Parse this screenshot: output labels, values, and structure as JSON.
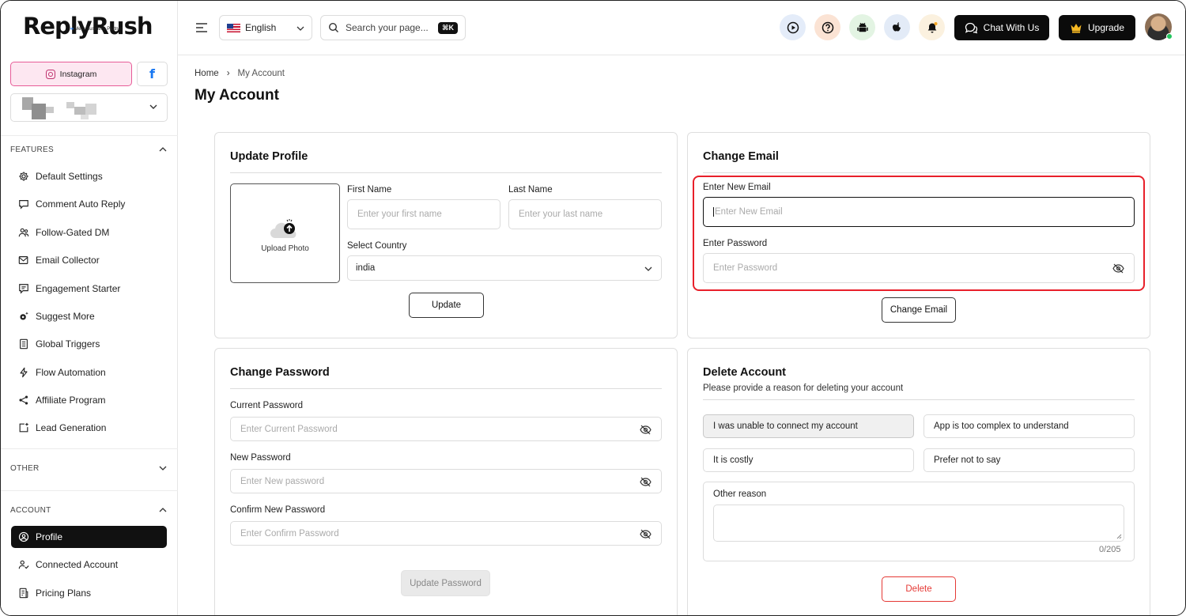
{
  "brand": {
    "name": "ReplyRush",
    "tagline": "Meta Business Partner"
  },
  "sidebar": {
    "platform_buttons": {
      "instagram": "Instagram",
      "facebook": "f"
    },
    "sections": {
      "features": "FEATURES",
      "other": "OTHER",
      "account": "ACCOUNT"
    },
    "features_items": [
      {
        "label": "Default Settings",
        "icon": "gear-icon"
      },
      {
        "label": "Comment Auto Reply",
        "icon": "comment-icon"
      },
      {
        "label": "Follow-Gated DM",
        "icon": "users-icon"
      },
      {
        "label": "Email Collector",
        "icon": "mail-icon"
      },
      {
        "label": "Engagement Starter",
        "icon": "chat-lines-icon"
      },
      {
        "label": "Suggest More",
        "icon": "sparkle-gear-icon"
      },
      {
        "label": "Global Triggers",
        "icon": "document-icon"
      },
      {
        "label": "Flow Automation",
        "icon": "bolt-icon"
      },
      {
        "label": "Affiliate Program",
        "icon": "share-icon"
      },
      {
        "label": "Lead Generation",
        "icon": "add-box-icon"
      }
    ],
    "account_items": [
      {
        "label": "Profile",
        "icon": "user-circle-icon",
        "active": true
      },
      {
        "label": "Connected Account",
        "icon": "user-check-icon",
        "active": false
      },
      {
        "label": "Pricing Plans",
        "icon": "receipt-icon",
        "active": false
      }
    ]
  },
  "topbar": {
    "language": "English",
    "search_placeholder": "Search your page...",
    "search_shortcut": "⌘K",
    "chat_label": "Chat With Us",
    "upgrade_label": "Upgrade",
    "icon_buttons": [
      "play-icon",
      "help-icon",
      "android-icon",
      "apple-icon",
      "bell-icon"
    ]
  },
  "breadcrumb": {
    "home": "Home",
    "separator": "›",
    "current": "My Account"
  },
  "page_title": "My Account",
  "update_profile": {
    "title": "Update Profile",
    "upload_label": "Upload Photo",
    "first_name_label": "First Name",
    "first_name_placeholder": "Enter your first name",
    "last_name_label": "Last Name",
    "last_name_placeholder": "Enter your last name",
    "country_label": "Select Country",
    "country_value": "india",
    "submit_label": "Update"
  },
  "change_email": {
    "title": "Change Email",
    "email_label": "Enter New Email",
    "email_placeholder": "Enter New Email",
    "password_label": "Enter Password",
    "password_placeholder": "Enter Password",
    "submit_label": "Change Email"
  },
  "change_password": {
    "title": "Change Password",
    "current_label": "Current Password",
    "current_placeholder": "Enter Current Password",
    "new_label": "New Password",
    "new_placeholder": "Enter New password",
    "confirm_label": "Confirm New Password",
    "confirm_placeholder": "Enter Confirm Password",
    "submit_label": "Update Password"
  },
  "delete_account": {
    "title": "Delete Account",
    "subtitle": "Please provide a reason for deleting your account",
    "reasons": [
      "I was unable to connect my account",
      "App is too complex to understand",
      "It is costly",
      "Prefer not to say"
    ],
    "selected_reason": "I was unable to connect my account",
    "other_label": "Other reason",
    "counter": "0/205",
    "submit_label": "Delete"
  },
  "colors": {
    "accent": "#111111",
    "highlight": "#e8202a",
    "danger": "#e53935",
    "instagram": "#e75c98",
    "facebook": "#1877f2"
  }
}
